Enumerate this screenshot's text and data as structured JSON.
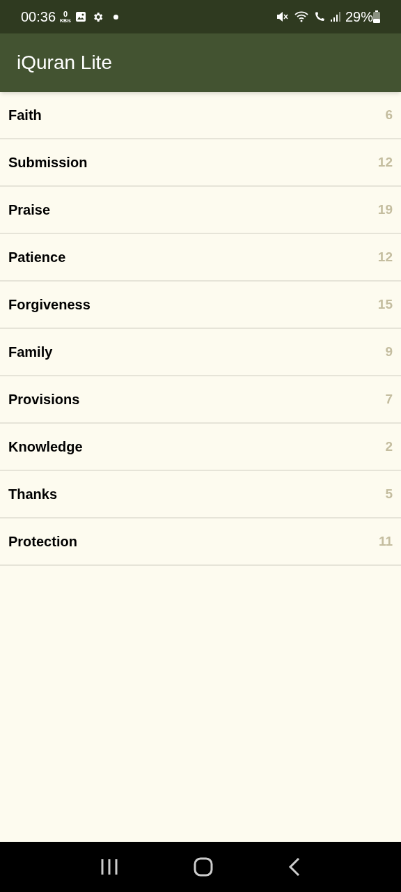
{
  "status_bar": {
    "time": "00:36",
    "net_speed": "0",
    "net_unit": "KB/s",
    "battery": "29%"
  },
  "app_bar": {
    "title": "iQuran Lite"
  },
  "topics": [
    {
      "label": "Faith",
      "count": "6"
    },
    {
      "label": "Submission",
      "count": "12"
    },
    {
      "label": "Praise",
      "count": "19"
    },
    {
      "label": "Patience",
      "count": "12"
    },
    {
      "label": "Forgiveness",
      "count": "15"
    },
    {
      "label": "Family",
      "count": "9"
    },
    {
      "label": "Provisions",
      "count": "7"
    },
    {
      "label": "Knowledge",
      "count": "2"
    },
    {
      "label": "Thanks",
      "count": "5"
    },
    {
      "label": "Protection",
      "count": "11"
    }
  ]
}
